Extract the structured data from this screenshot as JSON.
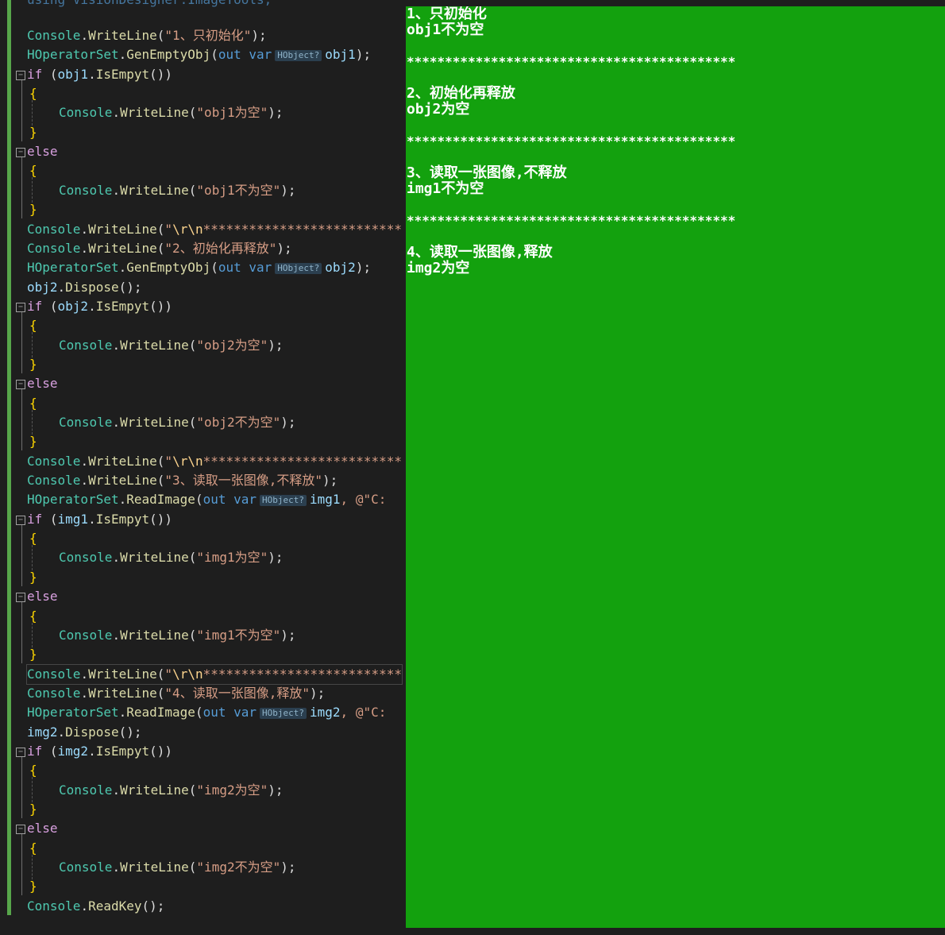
{
  "editor": {
    "top_partial": "using VisionDesigner.ImageTools;",
    "lines": [
      {
        "id": "l1",
        "kind": "call",
        "indent": 0,
        "cls": "Console",
        "method": "WriteLine",
        "str": "\"1、只初始化\"",
        "tail": ");"
      },
      {
        "id": "l2",
        "kind": "gen",
        "indent": 0,
        "cls": "HOperatorSet",
        "method": "GenEmptyObj",
        "kw1": "out",
        "kw2": "var",
        "hint": "HObject?",
        "var": "obj1",
        "tail": ");"
      },
      {
        "id": "l3",
        "kind": "if",
        "indent": 0,
        "ctrl": "if",
        "var": "obj1",
        "method": "IsEmpyt",
        "tail": "())"
      },
      {
        "id": "l4",
        "kind": "brace",
        "indent": 1,
        "text": "{"
      },
      {
        "id": "l5",
        "kind": "call",
        "indent": 2,
        "cls": "Console",
        "method": "WriteLine",
        "str": "\"obj1为空\"",
        "tail": ");"
      },
      {
        "id": "l6",
        "kind": "brace",
        "indent": 1,
        "text": "}"
      },
      {
        "id": "l7",
        "kind": "else",
        "indent": 0,
        "ctrl": "else"
      },
      {
        "id": "l8",
        "kind": "brace",
        "indent": 1,
        "text": "{"
      },
      {
        "id": "l9",
        "kind": "call",
        "indent": 2,
        "cls": "Console",
        "method": "WriteLine",
        "str": "\"obj1不为空\"",
        "tail": ");"
      },
      {
        "id": "l10",
        "kind": "brace",
        "indent": 1,
        "text": "}"
      },
      {
        "id": "l11",
        "kind": "sep",
        "indent": 0,
        "cls": "Console",
        "method": "WriteLine",
        "str": "\"",
        "esc": "\\r\\n",
        "stars": "**************************"
      },
      {
        "id": "l12",
        "kind": "call",
        "indent": 0,
        "cls": "Console",
        "method": "WriteLine",
        "str": "\"2、初始化再释放\"",
        "tail": ");"
      },
      {
        "id": "l13",
        "kind": "gen",
        "indent": 0,
        "cls": "HOperatorSet",
        "method": "GenEmptyObj",
        "kw1": "out",
        "kw2": "var",
        "hint": "HObject?",
        "var": "obj2",
        "tail": ");"
      },
      {
        "id": "l14",
        "kind": "dispose",
        "indent": 0,
        "var": "obj2",
        "method": "Dispose",
        "tail": "();"
      },
      {
        "id": "l15",
        "kind": "if",
        "indent": 0,
        "ctrl": "if",
        "var": "obj2",
        "method": "IsEmpyt",
        "tail": "())"
      },
      {
        "id": "l16",
        "kind": "brace",
        "indent": 1,
        "text": "{"
      },
      {
        "id": "l17",
        "kind": "call",
        "indent": 2,
        "cls": "Console",
        "method": "WriteLine",
        "str": "\"obj2为空\"",
        "tail": ");"
      },
      {
        "id": "l18",
        "kind": "brace",
        "indent": 1,
        "text": "}"
      },
      {
        "id": "l19",
        "kind": "else",
        "indent": 0,
        "ctrl": "else"
      },
      {
        "id": "l20",
        "kind": "brace",
        "indent": 1,
        "text": "{"
      },
      {
        "id": "l21",
        "kind": "call",
        "indent": 2,
        "cls": "Console",
        "method": "WriteLine",
        "str": "\"obj2不为空\"",
        "tail": ");"
      },
      {
        "id": "l22",
        "kind": "brace",
        "indent": 1,
        "text": "}"
      },
      {
        "id": "l23",
        "kind": "sep",
        "indent": 0,
        "cls": "Console",
        "method": "WriteLine",
        "str": "\"",
        "esc": "\\r\\n",
        "stars": "**************************"
      },
      {
        "id": "l24",
        "kind": "call",
        "indent": 0,
        "cls": "Console",
        "method": "WriteLine",
        "str": "\"3、读取一张图像,不释放\"",
        "tail": ");"
      },
      {
        "id": "l25",
        "kind": "read",
        "indent": 0,
        "cls": "HOperatorSet",
        "method": "ReadImage",
        "kw1": "out",
        "kw2": "var",
        "hint": "HObject?",
        "var": "img1",
        "tail": ", @\"C:"
      },
      {
        "id": "l26",
        "kind": "if",
        "indent": 0,
        "ctrl": "if",
        "var": "img1",
        "method": "IsEmpyt",
        "tail": "())"
      },
      {
        "id": "l27",
        "kind": "brace",
        "indent": 1,
        "text": "{"
      },
      {
        "id": "l28",
        "kind": "call",
        "indent": 2,
        "cls": "Console",
        "method": "WriteLine",
        "str": "\"img1为空\"",
        "tail": ");"
      },
      {
        "id": "l29",
        "kind": "brace",
        "indent": 1,
        "text": "}"
      },
      {
        "id": "l30",
        "kind": "else",
        "indent": 0,
        "ctrl": "else"
      },
      {
        "id": "l31",
        "kind": "brace",
        "indent": 1,
        "text": "{"
      },
      {
        "id": "l32",
        "kind": "call",
        "indent": 2,
        "cls": "Console",
        "method": "WriteLine",
        "str": "\"img1不为空\"",
        "tail": ");"
      },
      {
        "id": "l33",
        "kind": "brace",
        "indent": 1,
        "text": "}"
      },
      {
        "id": "l34",
        "kind": "sep",
        "indent": 0,
        "cls": "Console",
        "method": "WriteLine",
        "str": "\"",
        "esc": "\\r\\n",
        "stars": "**************************",
        "highlight": true
      },
      {
        "id": "l35",
        "kind": "call",
        "indent": 0,
        "cls": "Console",
        "method": "WriteLine",
        "str": "\"4、读取一张图像,释放\"",
        "tail": ");"
      },
      {
        "id": "l36",
        "kind": "read",
        "indent": 0,
        "cls": "HOperatorSet",
        "method": "ReadImage",
        "kw1": "out",
        "kw2": "var",
        "hint": "HObject?",
        "var": "img2",
        "tail": ", @\"C:"
      },
      {
        "id": "l37",
        "kind": "dispose",
        "indent": 0,
        "var": "img2",
        "method": "Dispose",
        "tail": "();"
      },
      {
        "id": "l38",
        "kind": "if",
        "indent": 0,
        "ctrl": "if",
        "var": "img2",
        "method": "IsEmpyt",
        "tail": "())"
      },
      {
        "id": "l39",
        "kind": "brace",
        "indent": 1,
        "text": "{"
      },
      {
        "id": "l40",
        "kind": "call",
        "indent": 2,
        "cls": "Console",
        "method": "WriteLine",
        "str": "\"img2为空\"",
        "tail": ");"
      },
      {
        "id": "l41",
        "kind": "brace",
        "indent": 1,
        "text": "}"
      },
      {
        "id": "l42",
        "kind": "else",
        "indent": 0,
        "ctrl": "else"
      },
      {
        "id": "l43",
        "kind": "brace",
        "indent": 1,
        "text": "{"
      },
      {
        "id": "l44",
        "kind": "call",
        "indent": 2,
        "cls": "Console",
        "method": "WriteLine",
        "str": "\"img2不为空\"",
        "tail": ");"
      },
      {
        "id": "l45",
        "kind": "brace",
        "indent": 1,
        "text": "}"
      },
      {
        "id": "l46",
        "kind": "readkey",
        "indent": 0,
        "cls": "Console",
        "method": "ReadKey",
        "tail": "();"
      }
    ],
    "fold_symbol": "−"
  },
  "console": {
    "lines": [
      {
        "text": "1、只初始化",
        "stars": false
      },
      {
        "text": "obj1不为空",
        "stars": false
      },
      {
        "text": "",
        "stars": false
      },
      {
        "text": "*******************************************",
        "stars": true
      },
      {
        "text": "",
        "stars": false
      },
      {
        "text": "2、初始化再释放",
        "stars": false
      },
      {
        "text": "obj2为空",
        "stars": false
      },
      {
        "text": "",
        "stars": false
      },
      {
        "text": "*******************************************",
        "stars": true
      },
      {
        "text": "",
        "stars": false
      },
      {
        "text": "3、读取一张图像,不释放",
        "stars": false
      },
      {
        "text": "img1不为空",
        "stars": false
      },
      {
        "text": "",
        "stars": false
      },
      {
        "text": "*******************************************",
        "stars": true
      },
      {
        "text": "",
        "stars": false
      },
      {
        "text": "4、读取一张图像,释放",
        "stars": false
      },
      {
        "text": "img2为空",
        "stars": false
      }
    ]
  },
  "colors": {
    "editor_bg": "#1e1e1e",
    "console_bg": "#13a10e",
    "console_text": "#ffffff",
    "change_bar": "#57a64a"
  }
}
